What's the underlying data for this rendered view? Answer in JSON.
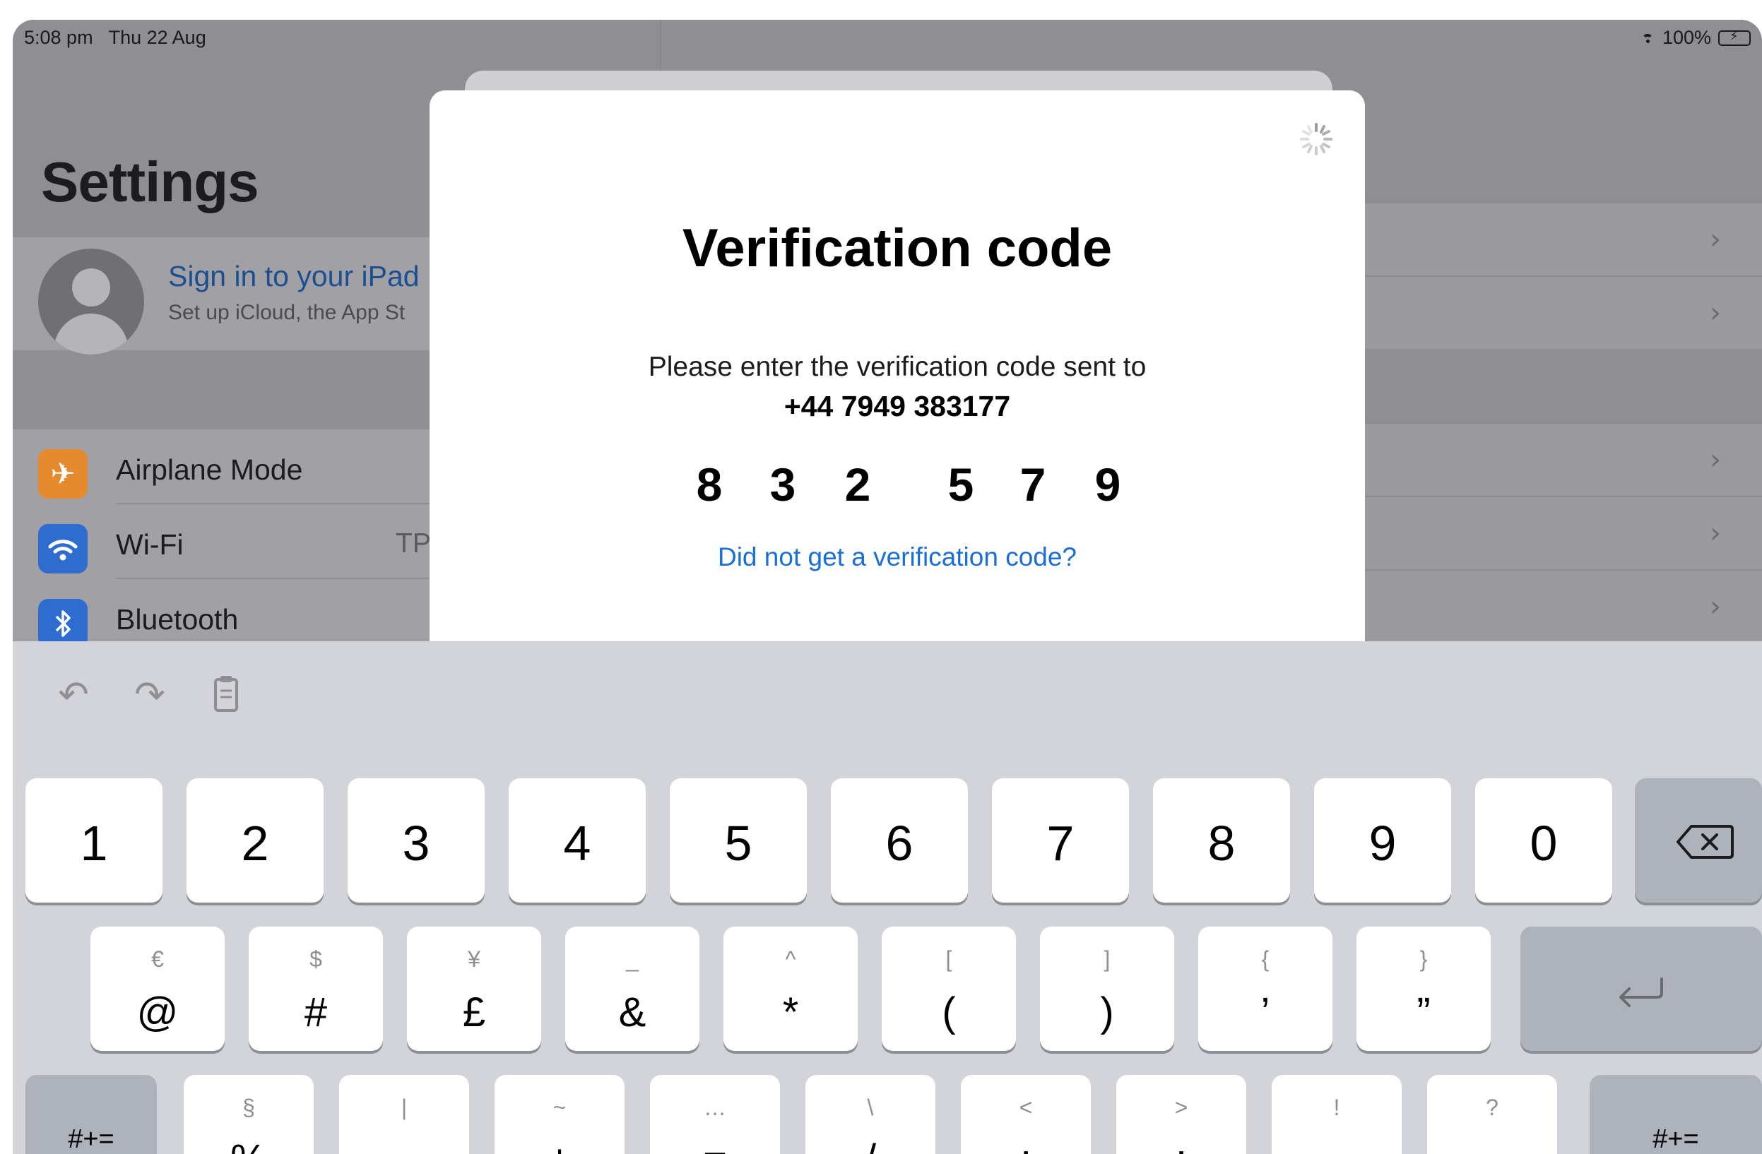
{
  "status_bar": {
    "time": "5:08 pm",
    "date": "Thu 22 Aug",
    "battery": "100%"
  },
  "settings": {
    "title": "Settings",
    "profile": {
      "title": "Sign in to your iPad",
      "subtitle": "Set up iCloud, the App St"
    },
    "rows": [
      {
        "label": "Airplane Mode",
        "icon": "airplane-icon",
        "icon_color": "#e58a2e",
        "value": ""
      },
      {
        "label": "Wi-Fi",
        "icon": "wifi-icon",
        "icon_color": "#2f6ccf",
        "value": "TP"
      },
      {
        "label": "Bluetooth",
        "icon": "bluetooth-icon",
        "icon_color": "#2f6ccf",
        "value": ""
      }
    ]
  },
  "modal": {
    "title": "Verification code",
    "text": "Please enter the verification code sent to",
    "phone": "+44 7949 383177",
    "code": [
      "8",
      "3",
      "2",
      "5",
      "7",
      "9"
    ],
    "resend_link": "Did not get a verification code?"
  },
  "keyboard": {
    "toolbar": [
      "undo-icon",
      "redo-icon",
      "paste-icon"
    ],
    "row1": [
      "1",
      "2",
      "3",
      "4",
      "5",
      "6",
      "7",
      "8",
      "9",
      "0"
    ],
    "row1_delete": "delete-icon",
    "row2": [
      {
        "main": "@",
        "alt": "€"
      },
      {
        "main": "#",
        "alt": "$"
      },
      {
        "main": "£",
        "alt": "¥"
      },
      {
        "main": "&",
        "alt": "_"
      },
      {
        "main": "*",
        "alt": "^"
      },
      {
        "main": "(",
        "alt": "["
      },
      {
        "main": ")",
        "alt": "]"
      },
      {
        "main": "’",
        "alt": "{"
      },
      {
        "main": "”",
        "alt": "}"
      }
    ],
    "row2_return": "return-icon",
    "row3_left": "#+=",
    "row3": [
      {
        "main": "%",
        "alt": "§"
      },
      {
        "main": "-",
        "alt": "|"
      },
      {
        "main": "+",
        "alt": "~"
      },
      {
        "main": "=",
        "alt": "…"
      },
      {
        "main": "/",
        "alt": "\\"
      },
      {
        "main": ";",
        "alt": "<"
      },
      {
        "main": ":",
        "alt": ">"
      },
      {
        "main": ",",
        "alt": "!"
      },
      {
        "main": ".",
        "alt": "?"
      }
    ],
    "row3_right": "#+="
  },
  "colors": {
    "link": "#1a6fd6",
    "keyboard_bg": "#d2d4da",
    "dim_bg": "#8e8e93"
  }
}
